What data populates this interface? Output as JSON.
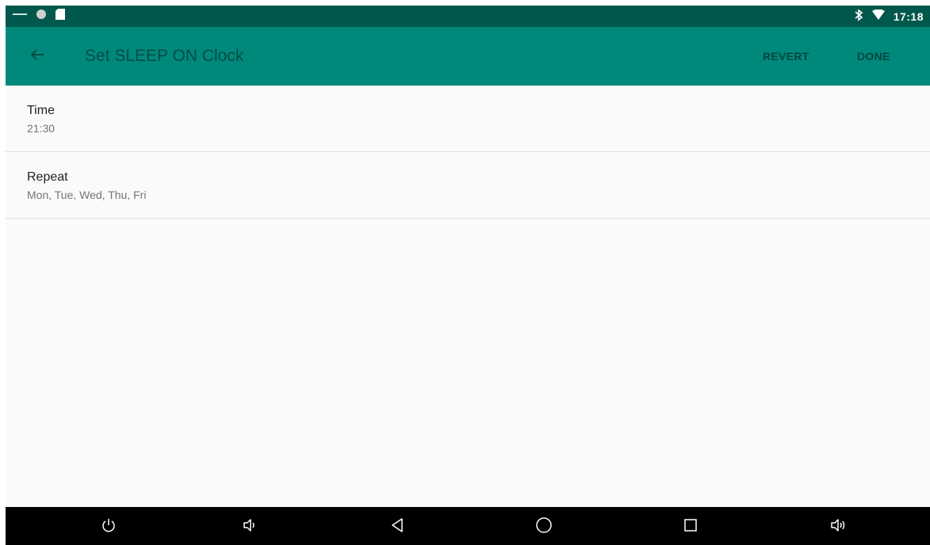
{
  "status_bar": {
    "time": "17:18",
    "left_icons": [
      "minus-icon",
      "circle-icon",
      "sd-card-icon"
    ],
    "right_icons": [
      "bluetooth-icon",
      "wifi-icon"
    ]
  },
  "app_bar": {
    "title": "Set SLEEP ON Clock",
    "back_icon": "arrow-back-icon",
    "revert_label": "REVERT",
    "done_label": "DONE",
    "color": "#00897b",
    "status_color": "#00574c"
  },
  "settings": [
    {
      "title": "Time",
      "summary": "21:30"
    },
    {
      "title": "Repeat",
      "summary": "Mon, Tue, Wed, Thu, Fri"
    }
  ],
  "nav_bar": {
    "buttons": [
      "power-icon",
      "volume-down-icon",
      "back-icon",
      "home-icon",
      "recents-icon",
      "volume-up-icon"
    ]
  }
}
